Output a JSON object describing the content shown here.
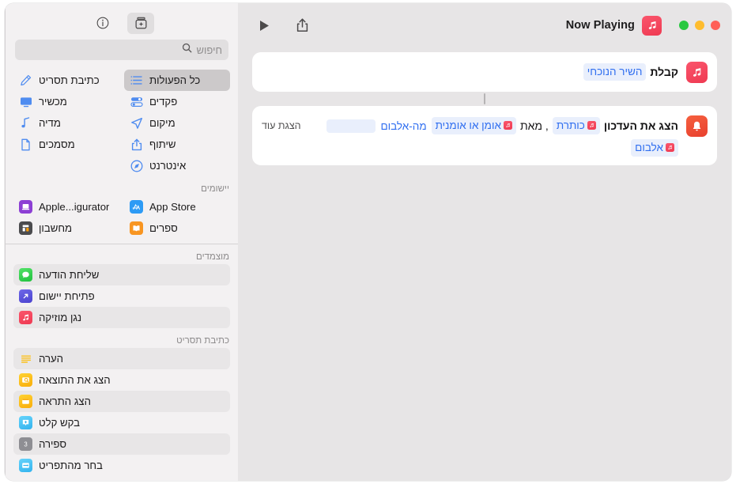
{
  "window": {
    "traffic_lights": [
      "close",
      "minimize",
      "zoom"
    ]
  },
  "main_toolbar": {
    "play_label": "play-shortcut",
    "share_label": "share",
    "title": "Now Playing",
    "app_icon": "music-icon"
  },
  "sidebar_toolbar": {
    "info_label": "info",
    "add_action_label": "add-action"
  },
  "search": {
    "placeholder": "חיפוש",
    "value": "",
    "icon": "search-icon"
  },
  "categories": [
    {
      "label": "כל הפעולות",
      "icon": "list-icon",
      "selected": true
    },
    {
      "label": "כתיבת תסריט",
      "icon": "script-icon",
      "selected": false
    },
    {
      "label": "פקדים",
      "icon": "controls-icon",
      "selected": false
    },
    {
      "label": "מכשיר",
      "icon": "display-icon",
      "selected": false
    },
    {
      "label": "מיקום",
      "icon": "location-arrow-icon",
      "selected": false
    },
    {
      "label": "מדיה",
      "icon": "music-note-icon",
      "selected": false
    },
    {
      "label": "שיתוף",
      "icon": "share-icon",
      "selected": false
    },
    {
      "label": "מסמכים",
      "icon": "document-icon",
      "selected": false
    },
    {
      "label": "אינטרנט",
      "icon": "safari-compass-icon",
      "selected": false
    }
  ],
  "apps_section": {
    "header": "יישומים",
    "items": [
      {
        "label": "App Store",
        "icon": "app-store-icon",
        "color": "#2d9bf5"
      },
      {
        "label": "Apple...igurator",
        "icon": "apple-configurator-icon",
        "color": "#8c3fd4"
      },
      {
        "label": "ספרים",
        "icon": "books-icon",
        "color": "#f89521"
      },
      {
        "label": "מחשבון",
        "icon": "calculator-icon",
        "color": "#4b4b4e"
      }
    ]
  },
  "pinned_section": {
    "header": "מוצמדים",
    "items": [
      {
        "label": "שליחת הודעה",
        "icon": "messages-icon",
        "color": "#3bd05a"
      },
      {
        "label": "פתיחת יישום",
        "icon": "open-app-icon",
        "color": "#5a53de"
      },
      {
        "label": "נגן מוזיקה",
        "icon": "music-icon",
        "color": "#f4374f"
      }
    ]
  },
  "scripting_section": {
    "header": "כתיבת תסריט",
    "items": [
      {
        "label": "הערה",
        "icon": "comment-icon",
        "color": "#ffffff"
      },
      {
        "label": "הצג את התוצאה",
        "icon": "show-result-icon",
        "color": "#fcc018"
      },
      {
        "label": "הצג התראה",
        "icon": "show-alert-icon",
        "color": "#fcc018"
      },
      {
        "label": "בקש קלט",
        "icon": "ask-for-input-icon",
        "color": "#4ec3f7"
      },
      {
        "label": "ספירה",
        "icon": "count-icon",
        "color": "#8e8e93"
      },
      {
        "label": "בחר מהתפריט",
        "icon": "choose-from-menu-icon",
        "color": "#4ec3f7"
      }
    ]
  },
  "workflow": {
    "cards": [
      {
        "icon": "music-icon",
        "icon_color": "#ef3a52",
        "lines": [
          {
            "parts": [
              {
                "type": "static",
                "text": "קבלת"
              },
              {
                "type": "token",
                "text": "השיר הנוכחי",
                "icon": null
              }
            ]
          }
        ]
      },
      {
        "icon": "bell-icon",
        "icon_color": "#e8402e",
        "lines": [
          {
            "show_more": "הצגת עוד",
            "has_drop_slot": true,
            "parts": [
              {
                "type": "static",
                "text": "הצג את העדכון"
              },
              {
                "type": "token",
                "text": "כותרת",
                "icon": "music-icon"
              },
              {
                "type": "plain",
                "text": ", מאת"
              },
              {
                "type": "token",
                "text": "אומן או אומנית",
                "icon": "music-icon"
              },
              {
                "type": "plainblue",
                "text": "מה-אלבום",
                "icon": null
              }
            ]
          },
          {
            "parts": [
              {
                "type": "token",
                "text": "אלבום",
                "icon": "music-icon"
              }
            ]
          }
        ]
      }
    ]
  },
  "colors": {
    "accent_blue": "#2f6ef0",
    "token_bg": "#e9effc",
    "sidebar_bg": "#f3f1f2",
    "canvas_bg": "#e7e5e6",
    "card_bg": "#ffffff",
    "selected_row": "#ccc9ca"
  }
}
